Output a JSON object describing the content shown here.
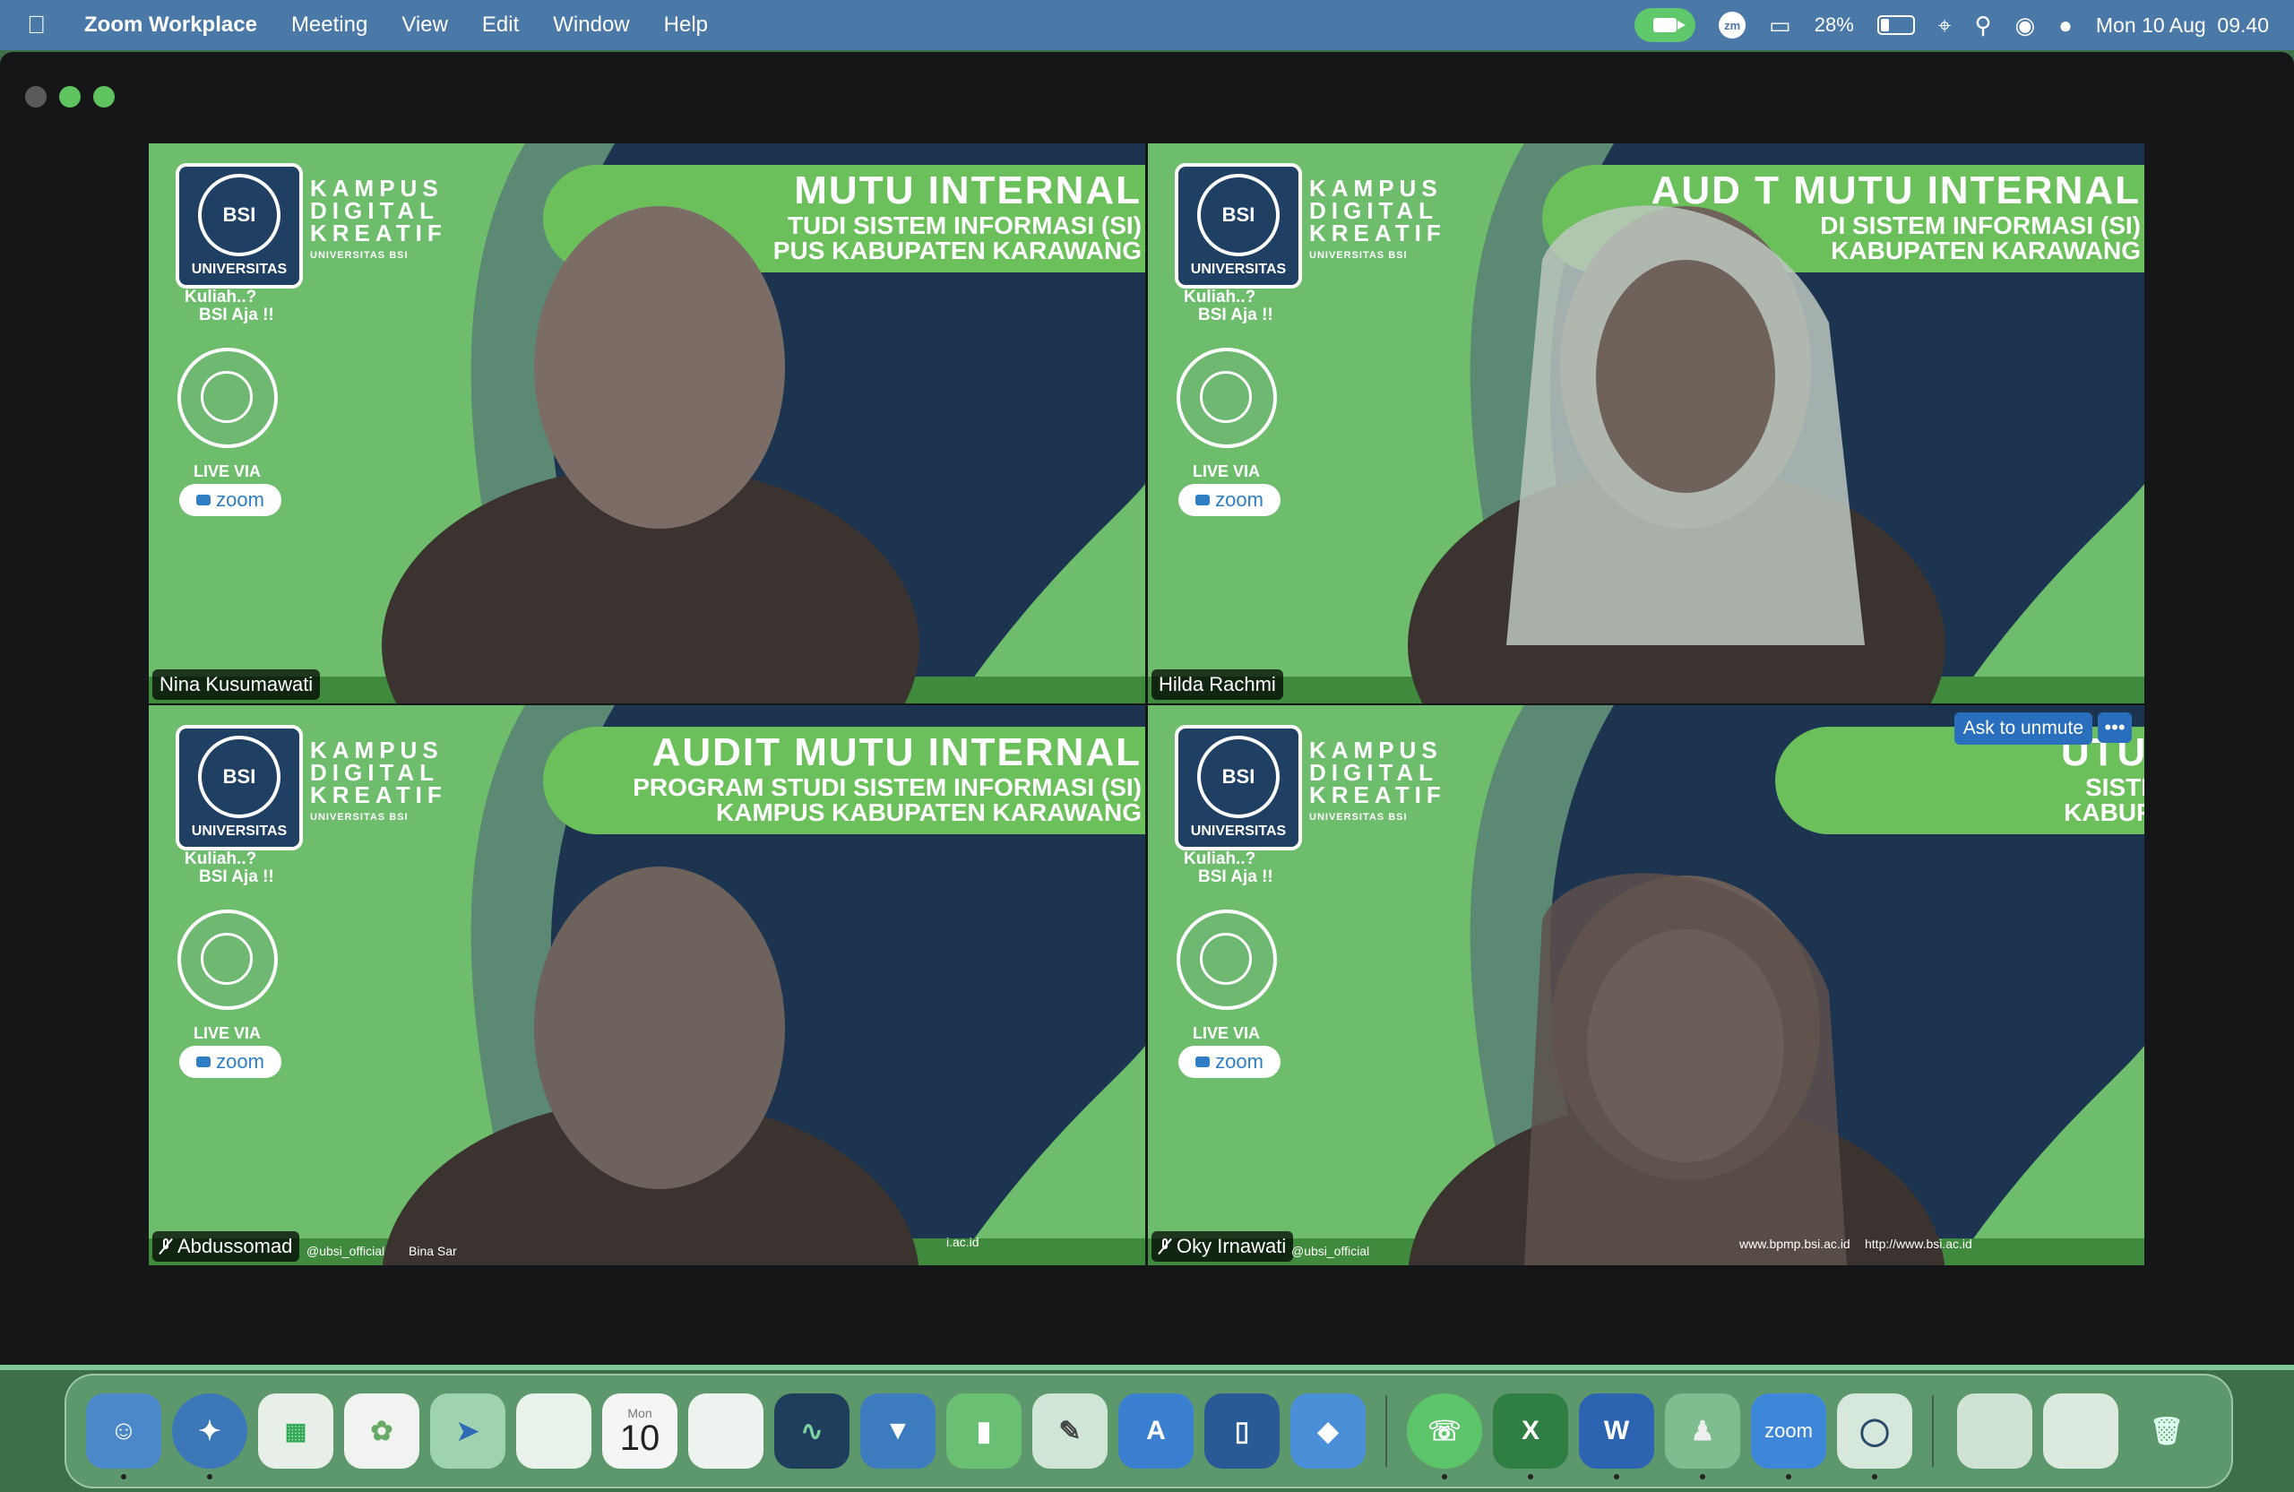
{
  "menubar": {
    "apple": "",
    "app_name": "Zoom Workplace",
    "items": [
      "Meeting",
      "View",
      "Edit",
      "Window",
      "Help"
    ],
    "zoom_status": "zm",
    "battery_percent": "28%",
    "battery_level": 0.28,
    "datetime": "Mon 10 Aug  09.40"
  },
  "tiles": [
    {
      "name": "Nina Kusumawati",
      "muted": false,
      "banner_line1": "MUTU INTERNAL",
      "banner_line2": "TUDI SISTEM INFORMASI (SI)",
      "banner_line3": "PUS KABUPATEN KARAWANG"
    },
    {
      "name": "Hilda Rachmi",
      "muted": false,
      "banner_line1": "AUD  T MUTU INTERNAL",
      "banner_line2": "DI SISTEM INFORMASI (SI)",
      "banner_line3": "KABUPATEN KARAWANG"
    },
    {
      "name": "Abdussomad",
      "muted": true,
      "banner_line1": "AUDIT MUTU INTERNAL",
      "banner_line2": "PROGRAM STUDI SISTEM INFORMASI (SI)",
      "banner_line3": "KAMPUS KABUPATEN KARAWANG"
    },
    {
      "name": "Oky Irnawati",
      "muted": true,
      "banner_line1": "UTU INTERNAL",
      "banner_line2": "SISTEM INFORMASI (SI)",
      "banner_line3": "KABUPATEN KARAWANG"
    }
  ],
  "background": {
    "kampus": "KAMPUS",
    "digital": "DIGITAL",
    "kreatif": "KREATIF",
    "univ_bsi": "UNIVERSITAS BSI",
    "universitas": "UNIVERSITAS",
    "kuliah1": "Kuliah..?",
    "kuliah2": "BSI Aja !!",
    "live_via": "LIVE VIA",
    "zoom": "zoom",
    "social1": "@ubsi_official",
    "social2": "Bina Sar",
    "url1": "www.bpmp.bsi.ac.id",
    "url2": "http://www.bsi.ac.id",
    "url_short": "i.ac.id"
  },
  "controls": {
    "ask_to_unmute": "Ask to unmute",
    "more": "•••"
  },
  "dock": {
    "calendar_month": "Mon",
    "calendar_day": "10",
    "zoom_label": "zoom"
  }
}
